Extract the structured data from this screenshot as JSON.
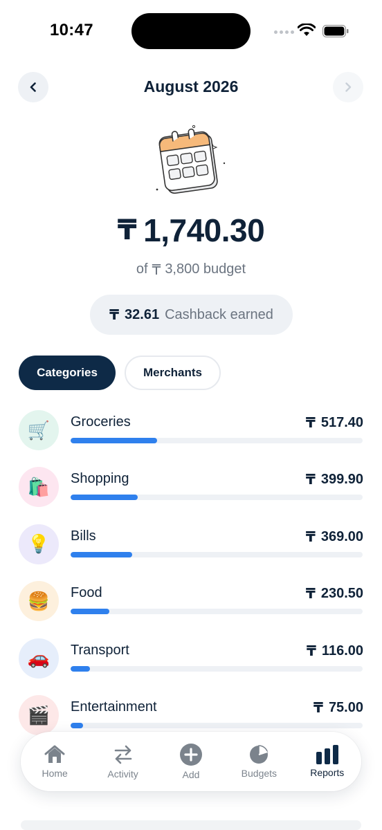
{
  "status_bar": {
    "time": "10:47"
  },
  "header": {
    "title": "August 2026",
    "prev_icon": "chevron-left-icon",
    "next_icon": "chevron-right-icon"
  },
  "illustration": "calendar-icon",
  "summary": {
    "currency": "₸",
    "total": "1,740.30",
    "budget_prefix": "of",
    "budget_value": "3,800 budget",
    "cashback_amount": "32.61",
    "cashback_label": "Cashback earned"
  },
  "segments": {
    "active": "Categories",
    "inactive": "Merchants"
  },
  "categories": [
    {
      "name": "Groceries",
      "amount": "517.40",
      "icon": "🛒",
      "icon_bg": "#e3f5ee",
      "progress": 0.297
    },
    {
      "name": "Shopping",
      "amount": "399.90",
      "icon": "🛍️",
      "icon_bg": "#fde6f0",
      "progress": 0.23
    },
    {
      "name": "Bills",
      "amount": "369.00",
      "icon": "💡",
      "icon_bg": "#ece9fb",
      "progress": 0.212
    },
    {
      "name": "Food",
      "amount": "230.50",
      "icon": "🍔",
      "icon_bg": "#fdf0dd",
      "progress": 0.132
    },
    {
      "name": "Transport",
      "amount": "116.00",
      "icon": "🚗",
      "icon_bg": "#e6eefb",
      "progress": 0.067
    },
    {
      "name": "Entertainment",
      "amount": "75.00",
      "icon": "🎬",
      "icon_bg": "#fde8e8",
      "progress": 0.043
    }
  ],
  "tabs": [
    {
      "label": "Home",
      "icon": "home-icon",
      "active": false
    },
    {
      "label": "Activity",
      "icon": "arrows-swap-icon",
      "active": false
    },
    {
      "label": "Add",
      "icon": "plus-circle-icon",
      "active": false
    },
    {
      "label": "Budgets",
      "icon": "pie-chart-icon",
      "active": false
    },
    {
      "label": "Reports",
      "icon": "bar-chart-icon",
      "active": true
    }
  ],
  "colors": {
    "accent": "#2f80ed",
    "primary": "#0e2a47",
    "muted": "#6b7480"
  }
}
